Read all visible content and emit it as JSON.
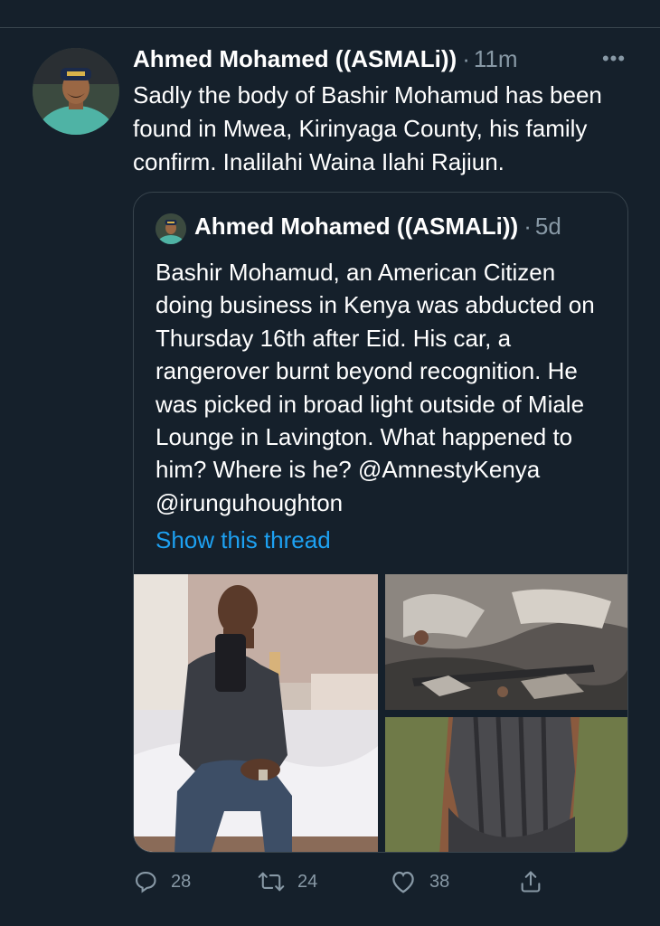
{
  "tweet": {
    "author": "Ahmed Mohamed ((ASMALi))",
    "separator": "·",
    "time": "11m",
    "more_icon": "more-dots-icon",
    "text": "Sadly the body of Bashir Mohamud has been found in Mwea, Kirinyaga County, his family confirm. Inalilahi Waina Ilahi Rajiun."
  },
  "quote": {
    "author": "Ahmed Mohamed ((ASMALi))",
    "separator": "·",
    "time": "5d",
    "text": "Bashir Mohamud, an American Citizen doing business in Kenya was abducted on Thursday 16th after Eid. His car, a rangerover burnt beyond recognition. He was picked in broad light outside of Miale Lounge in Lavington. What happened to him? Where is he? @AmnestyKenya @irunguhoughton",
    "show_thread": "Show this thread"
  },
  "actions": {
    "reply_count": "28",
    "retweet_count": "24",
    "like_count": "38",
    "icons": [
      "reply-icon",
      "retweet-icon",
      "like-icon",
      "share-icon"
    ]
  },
  "colors": {
    "background": "#15202b",
    "border": "#38444d",
    "muted": "#8899a6",
    "link": "#1da1f2"
  }
}
